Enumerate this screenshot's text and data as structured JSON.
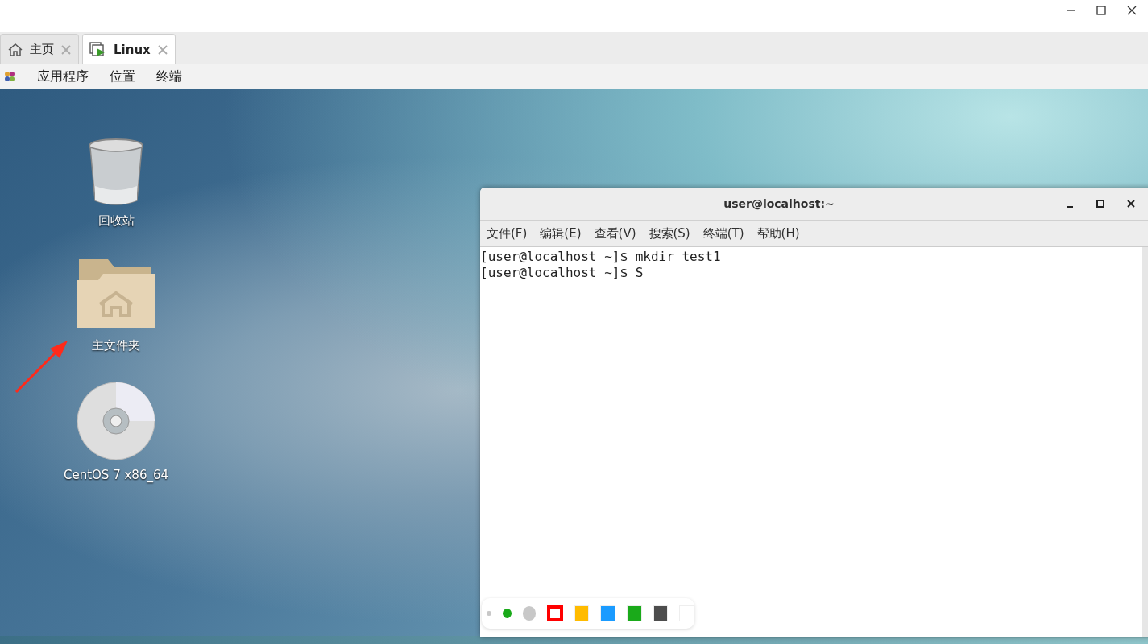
{
  "tabs": [
    {
      "label": "主页",
      "kind": "home",
      "selected": false
    },
    {
      "label": "Linux",
      "kind": "vm",
      "selected": true
    }
  ],
  "menubar": [
    "应用程序",
    "位置",
    "终端"
  ],
  "desktop_icons": [
    {
      "kind": "trash",
      "label": "回收站"
    },
    {
      "kind": "home-folder",
      "label": "主文件夹"
    },
    {
      "kind": "disc",
      "label": "CentOS 7 x86_64"
    }
  ],
  "terminal": {
    "title": "user@localhost:~",
    "menu": [
      "文件(F)",
      "编辑(E)",
      "查看(V)",
      "搜索(S)",
      "终端(T)",
      "帮助(H)"
    ],
    "lines": [
      "[user@localhost ~]$ mkdir test1",
      "[user@localhost ~]$ S"
    ]
  },
  "pen_sizes": [
    {
      "selected": false
    },
    {
      "selected": true
    },
    {
      "selected": false
    }
  ],
  "pen_colors": [
    {
      "color": "#ff0000",
      "selected": true
    },
    {
      "color": "#ffbb00",
      "selected": false
    },
    {
      "color": "#1a9bff",
      "selected": false
    },
    {
      "color": "#1aaa1a",
      "selected": false
    },
    {
      "color": "#4d4d4d",
      "selected": false
    },
    {
      "color": "#ffffff",
      "selected": false
    }
  ]
}
